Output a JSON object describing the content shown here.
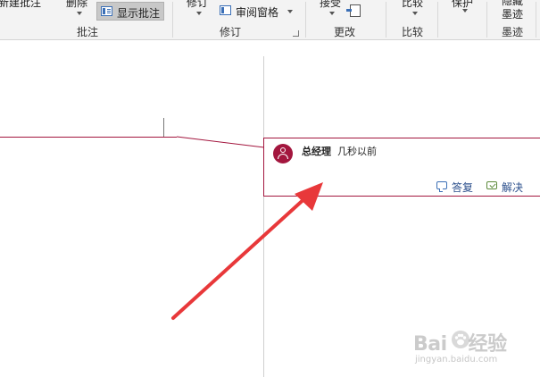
{
  "ribbon": {
    "comments_group": {
      "new_comment_label": "新建批注",
      "delete_label": "删除",
      "show_comments_label": "显示批注",
      "group_label": "批注"
    },
    "tracking_group": {
      "track_changes_label": "修订",
      "review_pane_label": "审阅窗格",
      "group_label": "修订"
    },
    "changes_group": {
      "accept_label": "接受",
      "group_label": "更改"
    },
    "compare_group": {
      "compare_label": "比较",
      "group_label": "比较"
    },
    "protect_group": {
      "label": "保护"
    },
    "ink_group": {
      "hide_ink_label": "隐藏墨迹",
      "group_label": "墨迹"
    }
  },
  "comment": {
    "author": "总经理",
    "time": "几秒以前",
    "reply_label": "答复",
    "resolve_label": "解决",
    "accent_color": "#a3163e"
  },
  "annotation": {
    "arrow_color": "#e8383a"
  },
  "watermark": {
    "logo_text_left": "Bai",
    "logo_text_right": "经验",
    "url": "jingyan.baidu.com"
  },
  "icons": [
    "show-comments-icon",
    "review-pane-icon",
    "accept-icon",
    "user-avatar-icon",
    "reply-icon",
    "resolve-icon",
    "baidu-paw-icon"
  ]
}
